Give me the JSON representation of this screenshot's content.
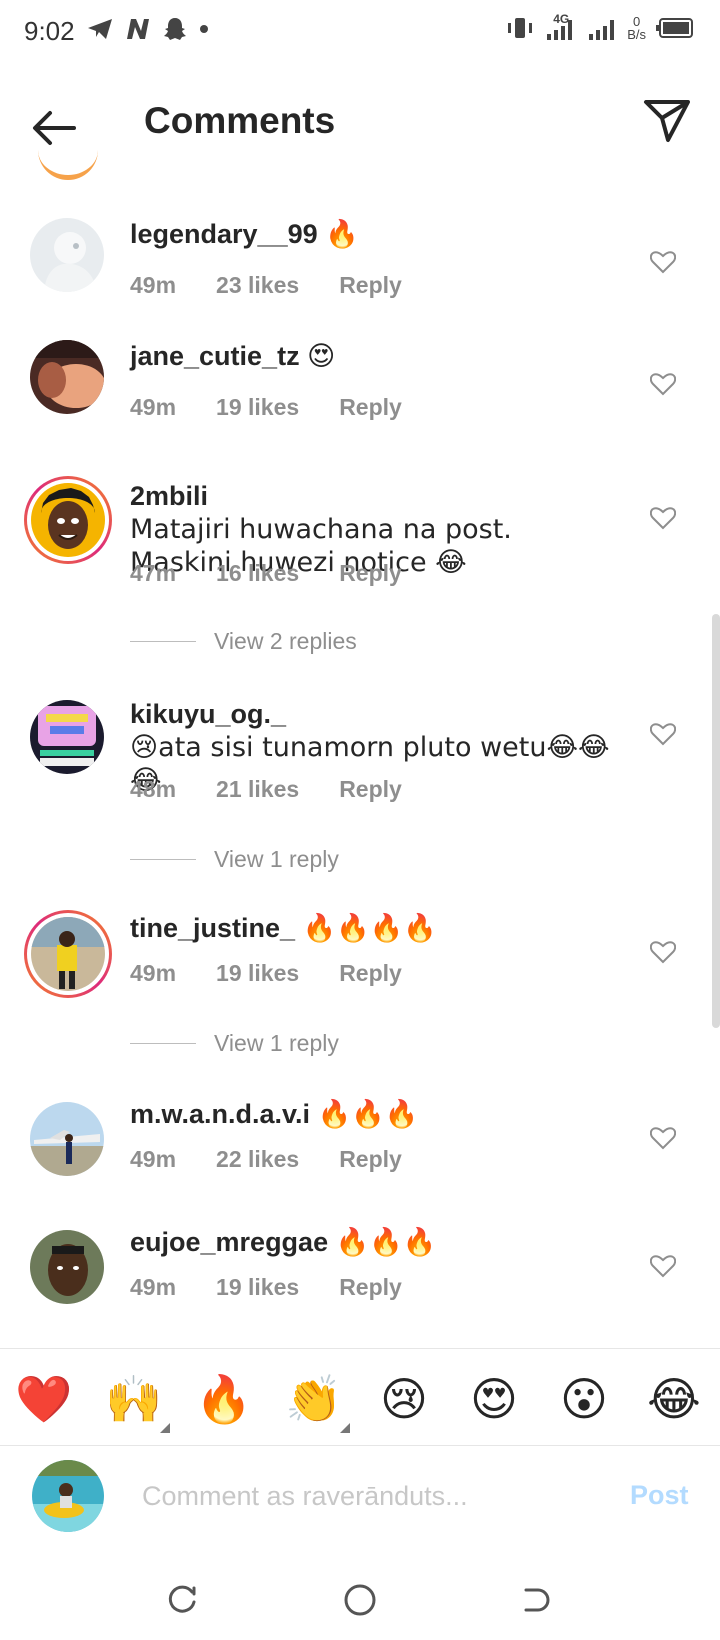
{
  "status_bar": {
    "time": "9:02",
    "left_icons": [
      "telegram-icon",
      "n-app-icon",
      "snapchat-icon",
      "dot-icon"
    ],
    "network": "4G",
    "speed_value": "0",
    "speed_unit": "B/s"
  },
  "header": {
    "title": "Comments",
    "back_icon": "arrow-left-icon",
    "send_icon": "paper-plane-icon"
  },
  "comments": [
    {
      "username": "legendary__99",
      "text": "🔥",
      "time": "49m",
      "likes": "23 likes",
      "reply": "Reply",
      "avatar": "white-statue-avatar",
      "story_ring": false
    },
    {
      "username": "jane_cutie_tz",
      "text": "😍",
      "time": "49m",
      "likes": "19 likes",
      "reply": "Reply",
      "avatar": "photo-avatar",
      "story_ring": false
    },
    {
      "username": "2mbili",
      "text": "Matajiri huwachana na post. Maskini huwezi notice 😂",
      "time": "47m",
      "likes": "16 likes",
      "reply": "Reply",
      "avatar": "cartoon-face-avatar",
      "story_ring": true,
      "view_replies": "View 2 replies"
    },
    {
      "username": "kikuyu_og._",
      "text": "😢ata sisi tunamorn pluto wetu😂😂😂",
      "time": "48m",
      "likes": "21 likes",
      "reply": "Reply",
      "avatar": "poster-avatar",
      "story_ring": false,
      "view_replies": "View 1 reply"
    },
    {
      "username": "tine_justine_",
      "text": "🔥🔥🔥🔥",
      "time": "49m",
      "likes": "19 likes",
      "reply": "Reply",
      "avatar": "photo-avatar",
      "story_ring": true,
      "view_replies": "View 1 reply"
    },
    {
      "username": "m.w.a.n.d.a.v.i",
      "text": "🔥🔥🔥",
      "time": "49m",
      "likes": "22 likes",
      "reply": "Reply",
      "avatar": "airplane-photo-avatar",
      "story_ring": false
    },
    {
      "username": "eujoe_mreggae",
      "text": "🔥🔥🔥",
      "time": "49m",
      "likes": "19 likes",
      "reply": "Reply",
      "avatar": "selfie-avatar",
      "story_ring": false
    }
  ],
  "reactions": [
    {
      "emoji": "❤️",
      "name": "heart"
    },
    {
      "emoji": "🙌",
      "name": "raising-hands"
    },
    {
      "emoji": "🔥",
      "name": "fire"
    },
    {
      "emoji": "👏",
      "name": "clapping-hands"
    },
    {
      "emoji": "😢",
      "name": "crying-face"
    },
    {
      "emoji": "😍",
      "name": "heart-eyes"
    },
    {
      "emoji": "😮",
      "name": "open-mouth"
    },
    {
      "emoji": "😂",
      "name": "tears-of-joy"
    }
  ],
  "comment_input": {
    "placeholder": "Comment as raverānduts...",
    "post_label": "Post"
  },
  "colors": {
    "text": "#262626",
    "meta": "#8e8e8e",
    "post_disabled": "#b3dbff",
    "story_ring_start": "#f58529",
    "story_ring_end": "#dd2a7b"
  }
}
